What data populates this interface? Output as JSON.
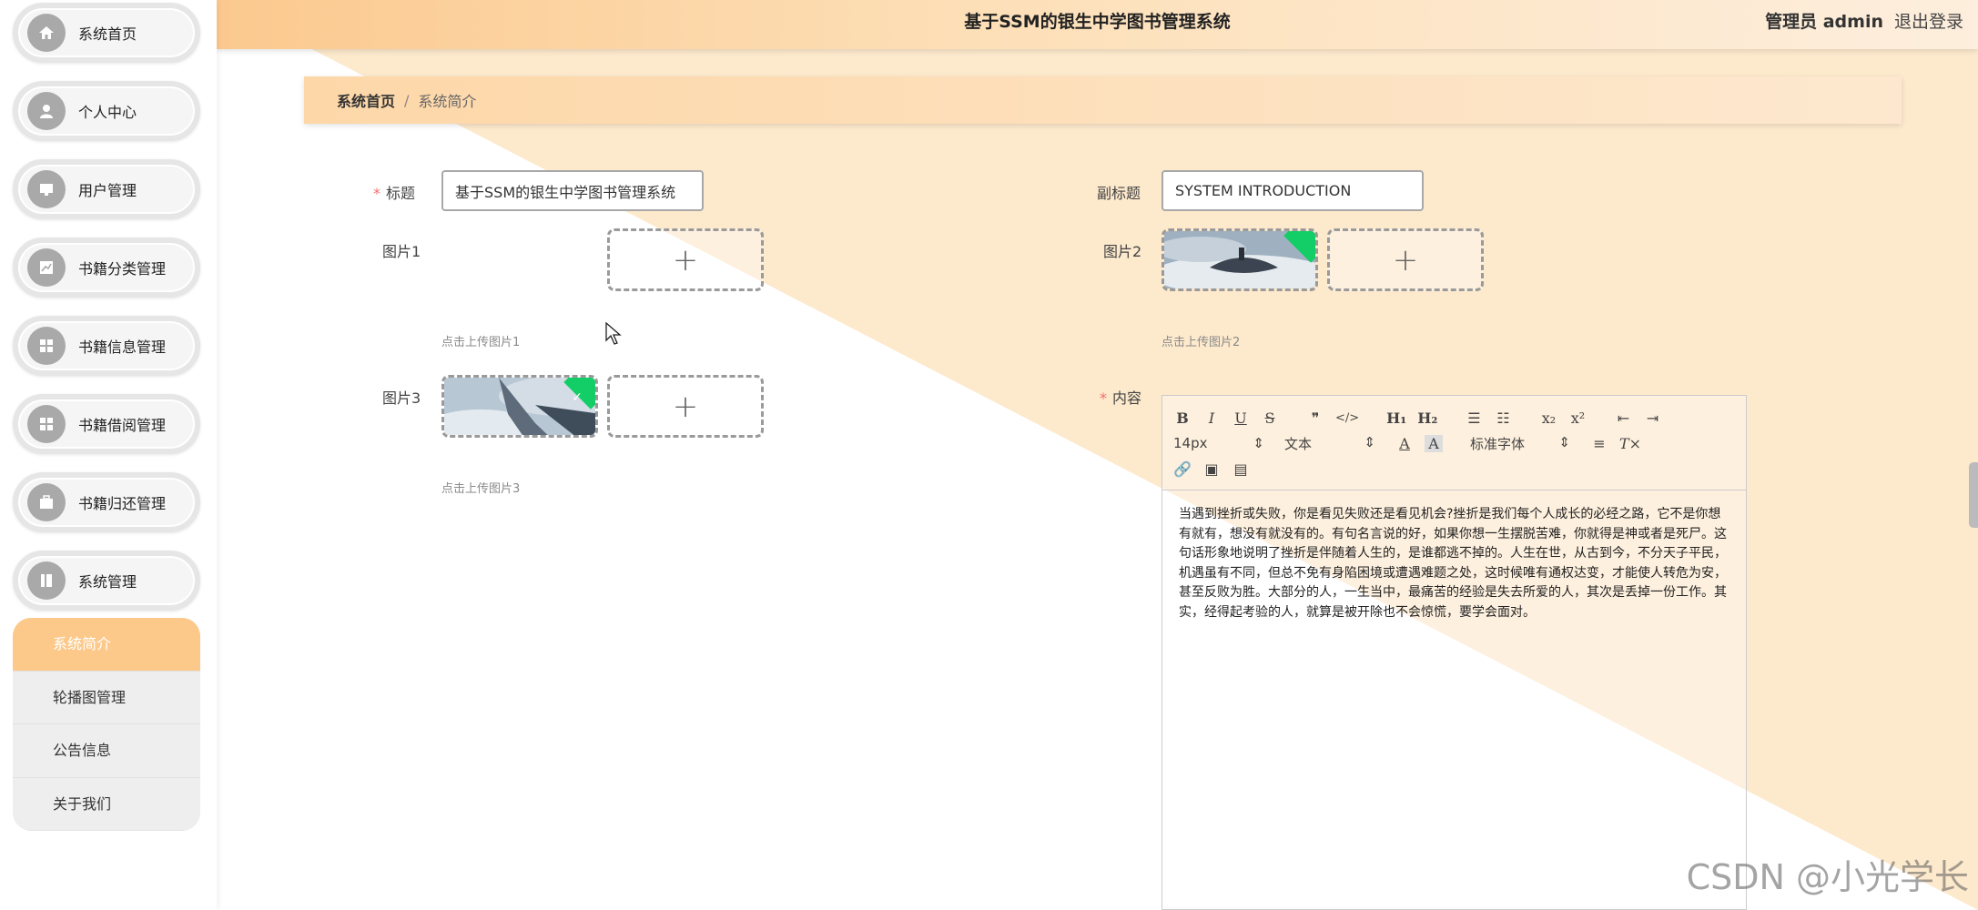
{
  "header": {
    "title": "基于SSM的银生中学图书管理系统",
    "user_label": "管理员 admin",
    "logout": "退出登录"
  },
  "sidebar": {
    "items": [
      {
        "label": "系统首页",
        "icon": "home-icon"
      },
      {
        "label": "个人中心",
        "icon": "user-icon"
      },
      {
        "label": "用户管理",
        "icon": "monitor-icon"
      },
      {
        "label": "书籍分类管理",
        "icon": "chart-icon"
      },
      {
        "label": "书籍信息管理",
        "icon": "grid-icon"
      },
      {
        "label": "书籍借阅管理",
        "icon": "grid-icon"
      },
      {
        "label": "书籍归还管理",
        "icon": "briefcase-icon"
      },
      {
        "label": "系统管理",
        "icon": "book-icon"
      }
    ],
    "submenu": [
      {
        "label": "系统简介",
        "active": true
      },
      {
        "label": "轮播图管理",
        "active": false
      },
      {
        "label": "公告信息",
        "active": false
      },
      {
        "label": "关于我们",
        "active": false
      }
    ]
  },
  "breadcrumb": {
    "home": "系统首页",
    "separator": "/",
    "current": "系统简介"
  },
  "form": {
    "title_label": "标题",
    "title_value": "基于SSM的银生中学图书管理系统",
    "subtitle_label": "副标题",
    "subtitle_value": "SYSTEM INTRODUCTION",
    "pic1_label": "图片1",
    "pic1_hint": "点击上传图片1",
    "pic2_label": "图片2",
    "pic2_hint": "点击上传图片2",
    "pic3_label": "图片3",
    "pic3_hint": "点击上传图片3",
    "content_label": "内容"
  },
  "editor": {
    "font_size": "14px",
    "text_type": "文本",
    "font_family": "标准字体",
    "content": "当遇到挫折或失败，你是看见失败还是看见机会?挫折是我们每个人成长的必经之路，它不是你想有就有，想没有就没有的。有句名言说的好，如果你想一生摆脱苦难，你就得是神或者是死尸。这句话形象地说明了挫折是伴随着人生的，是谁都逃不掉的。人生在世，从古到今，不分天子平民，机遇虽有不同，但总不免有身陷困境或遭遇难题之处，这时候唯有通权达变，才能使人转危为安，甚至反败为胜。大部分的人，一生当中，最痛苦的经验是失去所爱的人，其次是丢掉一份工作。其实，经得起考验的人，就算是被开除也不会惊慌，要学会面对。"
  },
  "watermark": "CSDN @小光学长",
  "colors": {
    "accent": "#fdc98a",
    "success": "#13ce66",
    "required": "#f56c6c"
  }
}
